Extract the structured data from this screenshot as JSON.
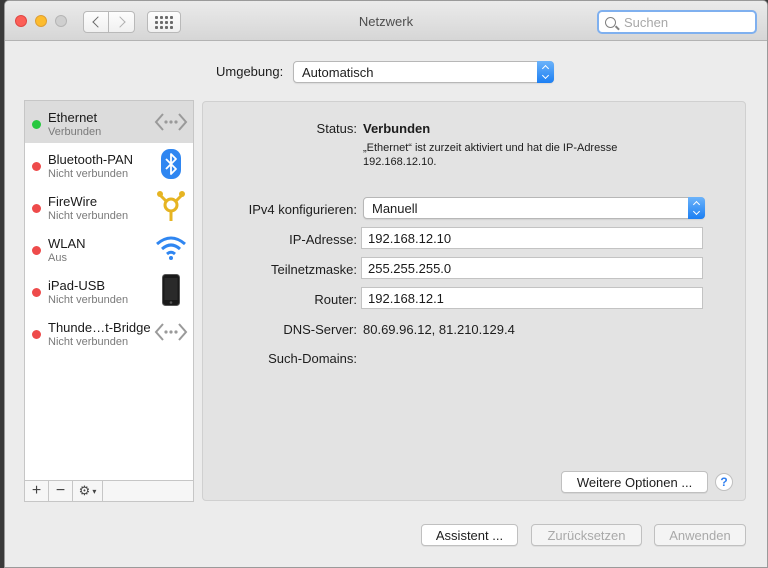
{
  "window": {
    "title": "Netzwerk"
  },
  "search": {
    "placeholder": "Suchen"
  },
  "location": {
    "label": "Umgebung:",
    "value": "Automatisch"
  },
  "interfaces": [
    {
      "name": "Ethernet",
      "status": "Verbunden",
      "status_color": "#28c840",
      "icon": "ethernet-icon"
    },
    {
      "name": "Bluetooth-PAN",
      "status": "Nicht verbunden",
      "status_color": "#ee4b4b",
      "icon": "bluetooth-icon"
    },
    {
      "name": "FireWire",
      "status": "Nicht verbunden",
      "status_color": "#ee4b4b",
      "icon": "firewire-icon"
    },
    {
      "name": "WLAN",
      "status": "Aus",
      "status_color": "#ee4b4b",
      "icon": "wifi-icon"
    },
    {
      "name": "iPad-USB",
      "status": "Nicht verbunden",
      "status_color": "#ee4b4b",
      "icon": "ipad-icon"
    },
    {
      "name": "Thunde…t-Bridge",
      "status": "Nicht verbunden",
      "status_color": "#ee4b4b",
      "icon": "thunderbolt-bridge-icon"
    }
  ],
  "sidebar_footer": {
    "add": "+",
    "remove": "−"
  },
  "detail": {
    "status_label": "Status:",
    "status_value": "Verbunden",
    "status_desc_line1": "„Ethernet“ ist zurzeit aktiviert und hat die IP-Adresse",
    "status_desc_line2": "192.168.12.10.",
    "ipv4_label": "IPv4 konfigurieren:",
    "ipv4_value": "Manuell",
    "ip_label": "IP-Adresse:",
    "ip_value": "192.168.12.10",
    "subnet_label": "Teilnetzmaske:",
    "subnet_value": "255.255.255.0",
    "router_label": "Router:",
    "router_value": "192.168.12.1",
    "dns_label": "DNS-Server:",
    "dns_value": "80.69.96.12, 81.210.129.4",
    "domains_label": "Such-Domains:",
    "advanced_button": "Weitere Optionen ...",
    "help": "?"
  },
  "footer": {
    "assistant": "Assistent ...",
    "revert": "Zurücksetzen",
    "apply": "Anwenden"
  },
  "colors": {
    "accent": "#1c7ff3",
    "connected": "#28c840",
    "disconnected": "#ee4b4b"
  }
}
